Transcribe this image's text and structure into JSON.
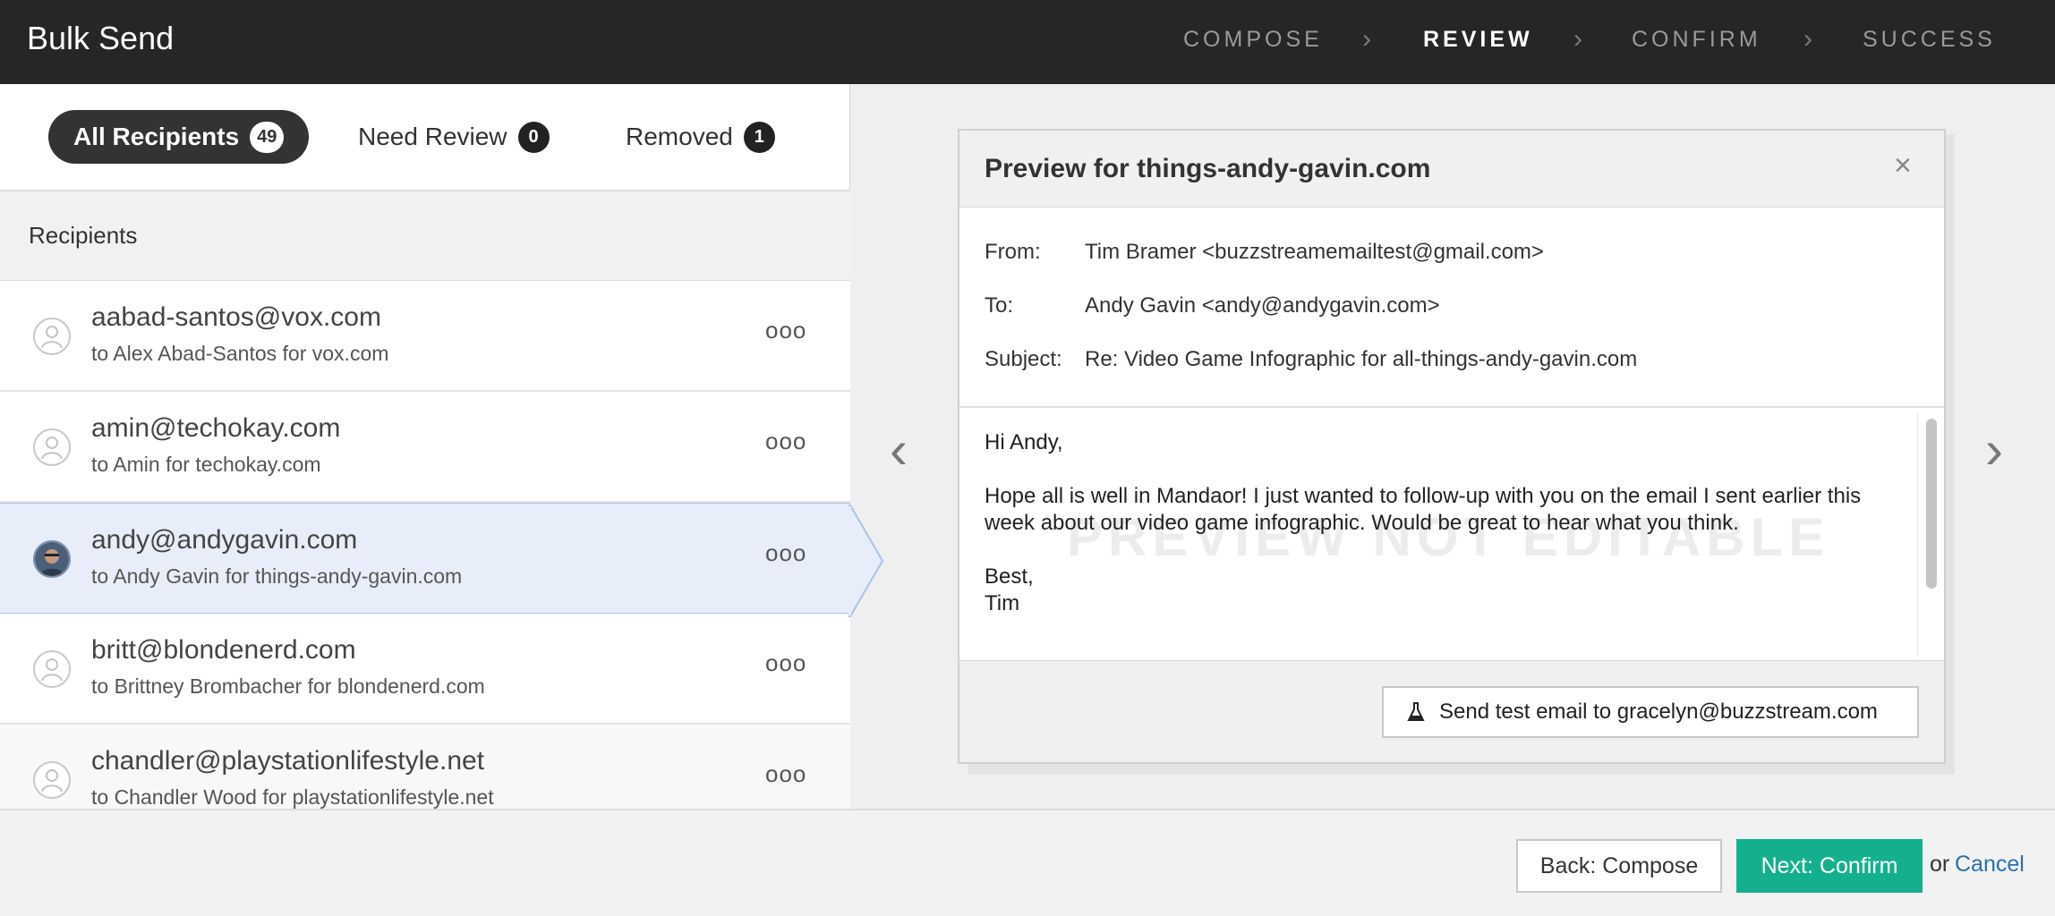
{
  "app": {
    "title": "Bulk Send"
  },
  "steps": [
    {
      "label": "COMPOSE",
      "active": false
    },
    {
      "label": "REVIEW",
      "active": true
    },
    {
      "label": "CONFIRM",
      "active": false
    },
    {
      "label": "SUCCESS",
      "active": false
    }
  ],
  "tabs": [
    {
      "label": "All Recipients",
      "count": "49",
      "active": true
    },
    {
      "label": "Need Review",
      "count": "0",
      "active": false
    },
    {
      "label": "Removed",
      "count": "1",
      "active": false
    }
  ],
  "recipients_header": "Recipients",
  "recipients": [
    {
      "email": "aabad-santos@vox.com",
      "sub": "to Alex Abad-Santos for vox.com",
      "selected": false
    },
    {
      "email": "amin@techokay.com",
      "sub": "to Amin for techokay.com",
      "selected": false
    },
    {
      "email": "andy@andygavin.com",
      "sub": "to Andy Gavin for things-andy-gavin.com",
      "selected": true
    },
    {
      "email": "britt@blondenerd.com",
      "sub": "to Brittney Brombacher for blondenerd.com",
      "selected": false
    },
    {
      "email": "chandler@playstationlifestyle.net",
      "sub": "to Chandler Wood for playstationlifestyle.net",
      "selected": false
    }
  ],
  "more_glyph": "ooo",
  "preview": {
    "title": "Preview for things-andy-gavin.com",
    "close_glyph": "×",
    "from_label": "From:",
    "from_value": "Tim Bramer <buzzstreamemailtest@gmail.com>",
    "to_label": "To:",
    "to_value": "Andy Gavin <andy@andygavin.com>",
    "subject_label": "Subject:",
    "subject_value": "Re: Video Game Infographic for all-things-andy-gavin.com",
    "watermark": "PREVIEW NOT EDITABLE",
    "body": {
      "greeting": "Hi Andy,",
      "paragraph": "Hope all is well in Mandaor! I just wanted to follow-up with you on the email I sent earlier this week about our video game infographic. Would be great to hear what you think.",
      "closing": "Best,",
      "signature": "Tim"
    },
    "test_button": "Send test email to gracelyn@buzzstream.com",
    "prev_glyph": "‹",
    "next_glyph": "›"
  },
  "footer": {
    "back_label": "Back: Compose",
    "next_label": "Next: Confirm",
    "or_text": "or",
    "cancel_label": "Cancel"
  },
  "colors": {
    "header_bg": "#262626",
    "accent": "#14b08e",
    "link": "#2a6fb5",
    "selected_row": "#e8eef9"
  },
  "icons": [
    "person-icon",
    "flask-icon",
    "more-icon",
    "close-icon",
    "chevron-left-icon",
    "chevron-right-icon"
  ]
}
